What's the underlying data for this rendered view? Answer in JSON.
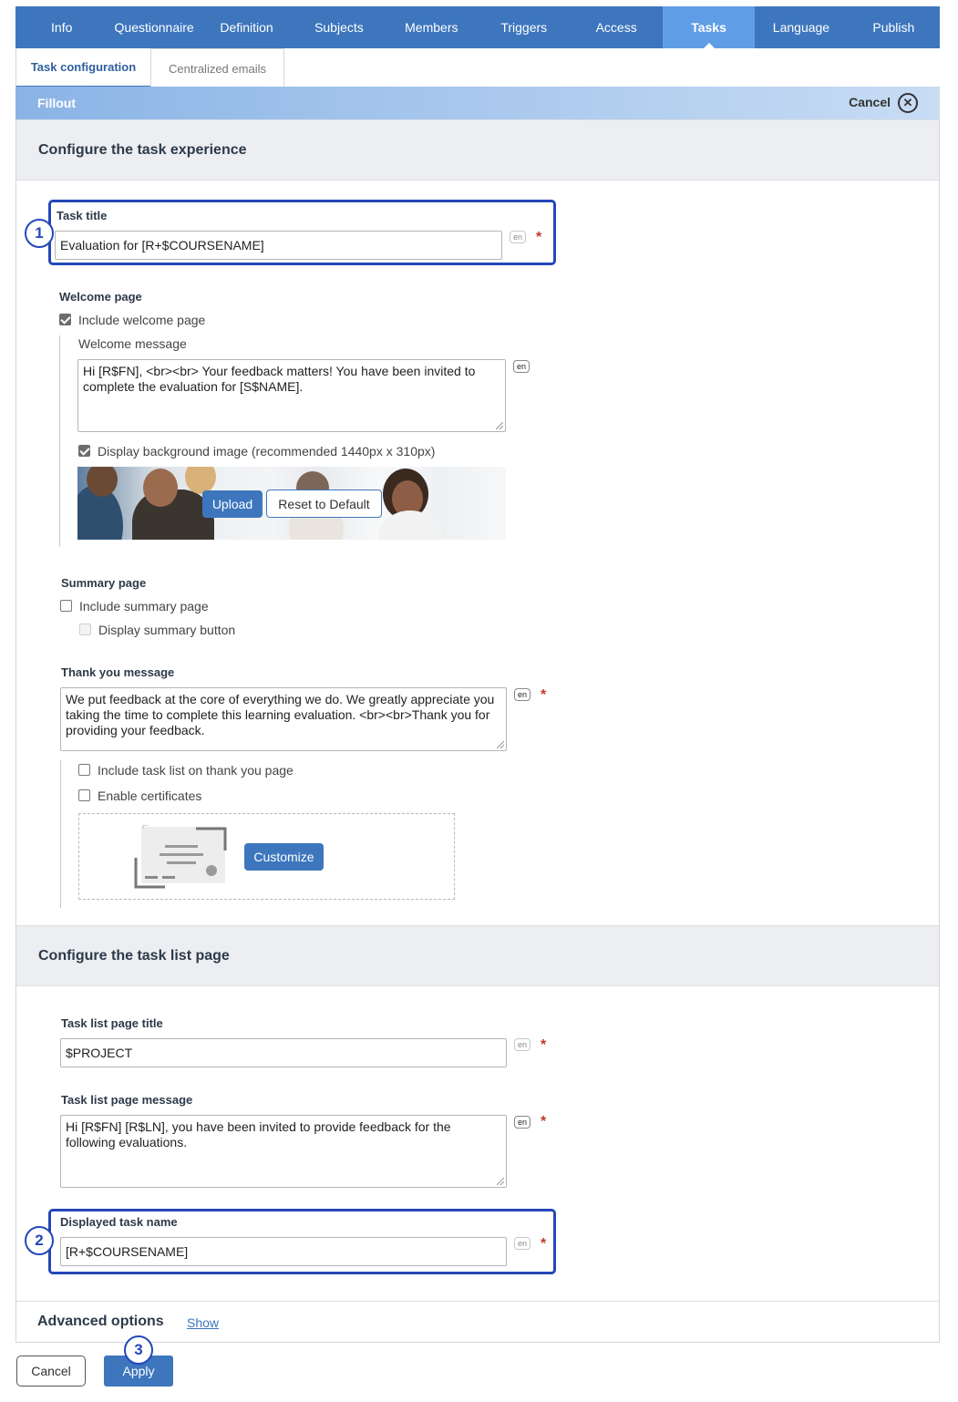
{
  "nav": {
    "tabs": [
      "Info",
      "Questionnaire",
      "Definition",
      "Subjects",
      "Members",
      "Triggers",
      "Access",
      "Tasks",
      "Language",
      "Publish"
    ],
    "active": "Tasks"
  },
  "subtabs": {
    "task_configuration": "Task configuration",
    "centralized_emails": "Centralized emails"
  },
  "fillout": {
    "title": "Fillout",
    "cancel": "Cancel"
  },
  "experience": {
    "heading": "Configure the task experience",
    "task_title_label": "Task title",
    "task_title_value": "Evaluation for [R+$COURSENAME]",
    "welcome_page_label": "Welcome page",
    "include_welcome_page": "Include welcome page",
    "welcome_message_label": "Welcome message",
    "welcome_message_value": "Hi [R$FN], <br><br> Your feedback matters! You have been invited to complete the evaluation for [S$NAME].",
    "display_bg_image": "Display background image (recommended 1440px x 310px)",
    "upload": "Upload",
    "reset_default": "Reset to Default",
    "summary_page_label": "Summary page",
    "include_summary_page": "Include summary page",
    "display_summary_button": "Display summary button",
    "thank_you_label": "Thank you message",
    "thank_you_value": "We put feedback at the core of everything we do. We greatly appreciate you taking the time to complete this learning evaluation. <br><br>Thank you for providing your feedback.",
    "include_task_list": "Include task list on thank you page",
    "enable_certificates": "Enable certificates",
    "customize": "Customize"
  },
  "task_list": {
    "heading": "Configure the task list page",
    "title_label": "Task list page title",
    "title_value": "$PROJECT",
    "message_label": "Task list page message",
    "message_value": "Hi [R$FN] [R$LN], you have been invited to provide feedback for the following evaluations.",
    "displayed_name_label": "Displayed task name",
    "displayed_name_value": "[R+$COURSENAME]"
  },
  "advanced": {
    "label": "Advanced options",
    "show": "Show"
  },
  "footer": {
    "cancel": "Cancel",
    "apply": "Apply"
  },
  "lang_tag": "en",
  "required_mark": "*",
  "annotations": [
    "1",
    "2",
    "3"
  ],
  "colors": {
    "nav": "#3d76bd",
    "nav_active": "#5f9ee6",
    "highlight": "#2447b8",
    "required": "#c0392b"
  }
}
